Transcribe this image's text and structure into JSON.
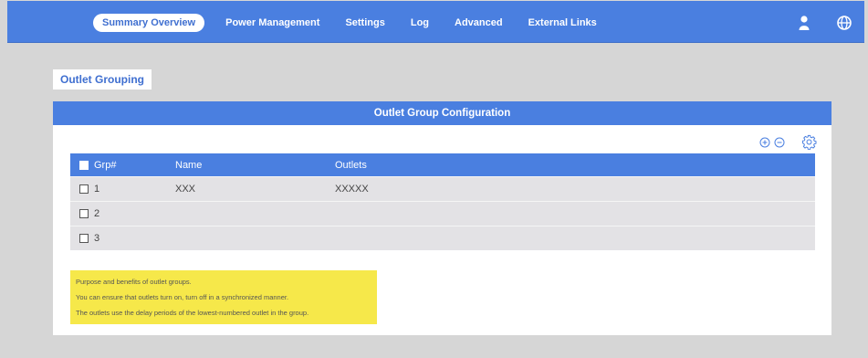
{
  "nav": {
    "items": [
      {
        "label": "Summary Overview",
        "active": true
      },
      {
        "label": "Power Management",
        "active": false
      },
      {
        "label": "Settings",
        "active": false
      },
      {
        "label": "Log",
        "active": false
      },
      {
        "label": "Advanced",
        "active": false
      },
      {
        "label": "External Links",
        "active": false
      }
    ],
    "icons": [
      "user-icon",
      "globe-icon"
    ]
  },
  "tab": {
    "label": "Outlet Grouping"
  },
  "panel": {
    "title": "Outlet Group Configuration",
    "tools": [
      "add-circle-icon",
      "remove-circle-icon",
      "gear-icon"
    ]
  },
  "table": {
    "columns": [
      "Grp#",
      "Name",
      "Outlets"
    ],
    "rows": [
      {
        "grp": "1",
        "name": "XXX",
        "outlets": "XXXXX"
      },
      {
        "grp": "2",
        "name": "",
        "outlets": ""
      },
      {
        "grp": "3",
        "name": "",
        "outlets": ""
      }
    ]
  },
  "note": {
    "lines": [
      "Purpose and benefits of outlet groups.",
      "You can ensure that outlets turn on, turn off in a synchronized manner.",
      "The outlets use the delay periods of the lowest-numbered outlet in the group."
    ]
  },
  "colors": {
    "accent": "#4a7fe0",
    "note_bg": "#f6e84a",
    "page_bg": "#d6d6d6"
  }
}
